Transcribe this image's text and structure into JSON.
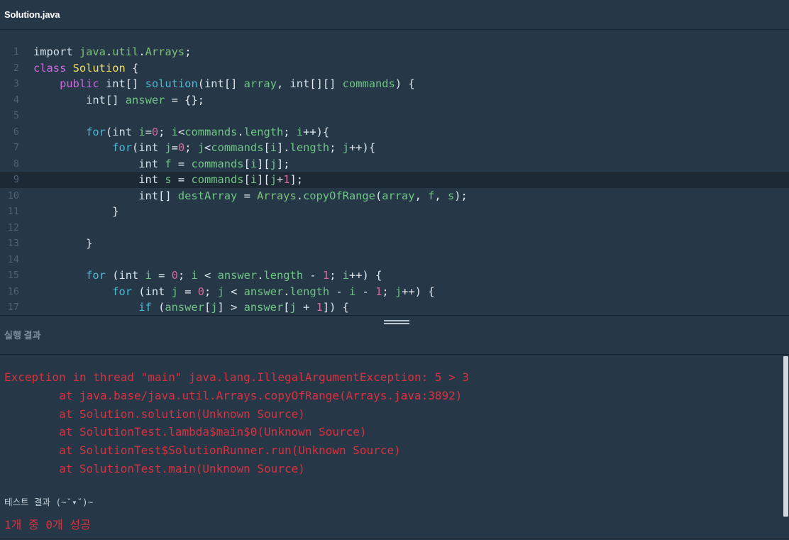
{
  "tab": {
    "title": "Solution.java"
  },
  "editor": {
    "active_line": 9,
    "lines": [
      {
        "n": "1",
        "t": [
          [
            "kw2",
            "import "
          ],
          [
            "pkg",
            "java"
          ],
          [
            "",
            "."
          ],
          [
            "pkg",
            "util"
          ],
          [
            "",
            "."
          ],
          [
            "pkg",
            "Arrays"
          ],
          [
            "",
            ";"
          ]
        ]
      },
      {
        "n": "2",
        "t": [
          [
            "kw",
            "class "
          ],
          [
            "cls",
            "Solution"
          ],
          [
            "",
            " {"
          ]
        ]
      },
      {
        "n": "3",
        "t": [
          [
            "",
            "    "
          ],
          [
            "kw",
            "public "
          ],
          [
            "kw2",
            "int"
          ],
          [
            "",
            "[] "
          ],
          [
            "fn",
            "solution"
          ],
          [
            "",
            "("
          ],
          [
            "kw2",
            "int"
          ],
          [
            "",
            "[] "
          ],
          [
            "var",
            "array"
          ],
          [
            "",
            ", "
          ],
          [
            "kw2",
            "int"
          ],
          [
            "",
            "[][] "
          ],
          [
            "var",
            "commands"
          ],
          [
            "",
            ") {"
          ]
        ]
      },
      {
        "n": "4",
        "t": [
          [
            "",
            "        "
          ],
          [
            "kw2",
            "int"
          ],
          [
            "",
            "[] "
          ],
          [
            "var",
            "answer"
          ],
          [
            "",
            " = {};"
          ]
        ]
      },
      {
        "n": "5",
        "t": []
      },
      {
        "n": "6",
        "t": [
          [
            "",
            "        "
          ],
          [
            "fn",
            "for"
          ],
          [
            "",
            "("
          ],
          [
            "kw2",
            "int "
          ],
          [
            "var",
            "i"
          ],
          [
            "",
            "="
          ],
          [
            "num",
            "0"
          ],
          [
            "",
            "; "
          ],
          [
            "var",
            "i"
          ],
          [
            "",
            "<"
          ],
          [
            "var",
            "commands"
          ],
          [
            "",
            "."
          ],
          [
            "var",
            "length"
          ],
          [
            "",
            "; "
          ],
          [
            "var",
            "i"
          ],
          [
            "",
            "++){"
          ]
        ]
      },
      {
        "n": "7",
        "t": [
          [
            "",
            "            "
          ],
          [
            "fn",
            "for"
          ],
          [
            "",
            "("
          ],
          [
            "kw2",
            "int "
          ],
          [
            "var",
            "j"
          ],
          [
            "",
            "="
          ],
          [
            "num",
            "0"
          ],
          [
            "",
            "; "
          ],
          [
            "var",
            "j"
          ],
          [
            "",
            "<"
          ],
          [
            "var",
            "commands"
          ],
          [
            "",
            "["
          ],
          [
            "var",
            "i"
          ],
          [
            "",
            "]."
          ],
          [
            "var",
            "length"
          ],
          [
            "",
            "; "
          ],
          [
            "var",
            "j"
          ],
          [
            "",
            "++){"
          ]
        ]
      },
      {
        "n": "8",
        "t": [
          [
            "",
            "                "
          ],
          [
            "kw2",
            "int "
          ],
          [
            "var",
            "f"
          ],
          [
            "",
            " = "
          ],
          [
            "var",
            "commands"
          ],
          [
            "",
            "["
          ],
          [
            "var",
            "i"
          ],
          [
            "",
            "]["
          ],
          [
            "var",
            "j"
          ],
          [
            "",
            "];"
          ]
        ]
      },
      {
        "n": "9",
        "t": [
          [
            "",
            "                "
          ],
          [
            "kw2",
            "int "
          ],
          [
            "var",
            "s"
          ],
          [
            "",
            " = "
          ],
          [
            "var",
            "commands"
          ],
          [
            "",
            "["
          ],
          [
            "var",
            "i"
          ],
          [
            "",
            "]["
          ],
          [
            "var",
            "j"
          ],
          [
            "",
            "+"
          ],
          [
            "num",
            "1"
          ],
          [
            "",
            "];"
          ]
        ]
      },
      {
        "n": "10",
        "t": [
          [
            "",
            "                "
          ],
          [
            "kw2",
            "int"
          ],
          [
            "",
            "[] "
          ],
          [
            "var",
            "destArray"
          ],
          [
            "",
            " = "
          ],
          [
            "pkg",
            "Arrays"
          ],
          [
            "",
            "."
          ],
          [
            "var",
            "copyOfRange"
          ],
          [
            "",
            "("
          ],
          [
            "var",
            "array"
          ],
          [
            "",
            ", "
          ],
          [
            "var",
            "f"
          ],
          [
            "",
            ", "
          ],
          [
            "var",
            "s"
          ],
          [
            "",
            ");"
          ]
        ]
      },
      {
        "n": "11",
        "t": [
          [
            "",
            "            }"
          ]
        ]
      },
      {
        "n": "12",
        "t": []
      },
      {
        "n": "13",
        "t": [
          [
            "",
            "        }"
          ]
        ]
      },
      {
        "n": "14",
        "t": []
      },
      {
        "n": "15",
        "t": [
          [
            "",
            "        "
          ],
          [
            "fn",
            "for"
          ],
          [
            "",
            " ("
          ],
          [
            "kw2",
            "int "
          ],
          [
            "var",
            "i"
          ],
          [
            "",
            " = "
          ],
          [
            "num",
            "0"
          ],
          [
            "",
            "; "
          ],
          [
            "var",
            "i"
          ],
          [
            "",
            " < "
          ],
          [
            "var",
            "answer"
          ],
          [
            "",
            "."
          ],
          [
            "var",
            "length"
          ],
          [
            "",
            " - "
          ],
          [
            "num",
            "1"
          ],
          [
            "",
            "; "
          ],
          [
            "var",
            "i"
          ],
          [
            "",
            "++) {"
          ]
        ]
      },
      {
        "n": "16",
        "t": [
          [
            "",
            "            "
          ],
          [
            "fn",
            "for"
          ],
          [
            "",
            " ("
          ],
          [
            "kw2",
            "int "
          ],
          [
            "var",
            "j"
          ],
          [
            "",
            " = "
          ],
          [
            "num",
            "0"
          ],
          [
            "",
            "; "
          ],
          [
            "var",
            "j"
          ],
          [
            "",
            " < "
          ],
          [
            "var",
            "answer"
          ],
          [
            "",
            "."
          ],
          [
            "var",
            "length"
          ],
          [
            "",
            " - "
          ],
          [
            "var",
            "i"
          ],
          [
            "",
            " - "
          ],
          [
            "num",
            "1"
          ],
          [
            "",
            "; "
          ],
          [
            "var",
            "j"
          ],
          [
            "",
            "++) {"
          ]
        ]
      },
      {
        "n": "17",
        "t": [
          [
            "",
            "                "
          ],
          [
            "fn",
            "if"
          ],
          [
            "",
            " ("
          ],
          [
            "var",
            "answer"
          ],
          [
            "",
            "["
          ],
          [
            "var",
            "j"
          ],
          [
            "",
            "] > "
          ],
          [
            "var",
            "answer"
          ],
          [
            "",
            "["
          ],
          [
            "var",
            "j"
          ],
          [
            "",
            " + "
          ],
          [
            "num",
            "1"
          ],
          [
            "",
            "]) {"
          ]
        ]
      }
    ]
  },
  "result": {
    "header": "실행 결과",
    "errors": [
      "Exception in thread \"main\" java.lang.IllegalArgumentException: 5 > 3",
      "        at java.base/java.util.Arrays.copyOfRange(Arrays.java:3892)",
      "        at Solution.solution(Unknown Source)",
      "        at SolutionTest.lambda$main$0(Unknown Source)",
      "        at SolutionTest$SolutionRunner.run(Unknown Source)",
      "        at SolutionTest.main(Unknown Source)"
    ],
    "test_label": "테스트 결과 (~˘▾˘)~",
    "test_summary": "1개 중 0개 성공"
  },
  "colors": {
    "background": "#263747",
    "error": "#d7323f",
    "keyword": "#cc6be0",
    "class": "#f3df5f",
    "function": "#4dbad5",
    "variable": "#6fc584",
    "number": "#d1699b"
  }
}
